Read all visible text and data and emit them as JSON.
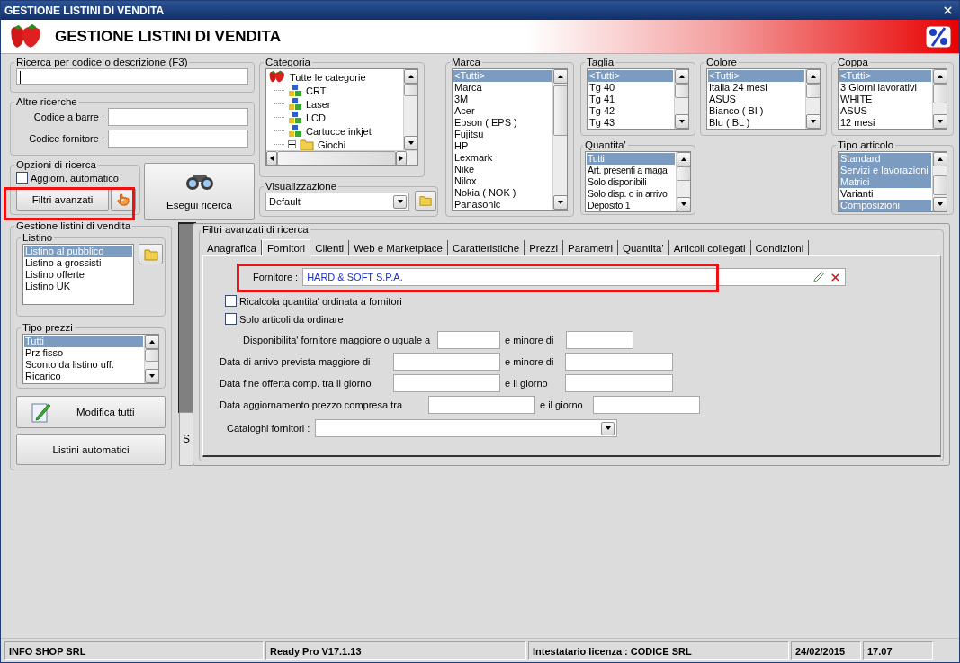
{
  "window": {
    "title": "GESTIONE LISTINI DI VENDITA"
  },
  "header": {
    "title": "GESTIONE LISTINI DI VENDITA"
  },
  "search_code": {
    "label": "Ricerca per codice o descrizione (F3)"
  },
  "other_searches": {
    "label": "Altre ricerche",
    "fields": [
      {
        "label": "Codice a barre :"
      },
      {
        "label": "Codice fornitore :"
      }
    ]
  },
  "search_options": {
    "label": "Opzioni di ricerca",
    "auto_update": {
      "label": "Aggiorn. automatico",
      "checked": false
    },
    "advanced_button": "Filtri avanzati"
  },
  "run_search_button": "Esegui ricerca",
  "category": {
    "label": "Categoria",
    "tree": [
      {
        "label": "Tutte le categorie",
        "kind": "root",
        "children": [
          {
            "label": "CRT",
            "kind": "category"
          },
          {
            "label": "Laser",
            "kind": "category"
          },
          {
            "label": "LCD",
            "kind": "category"
          },
          {
            "label": "Cartucce inkjet",
            "kind": "category"
          },
          {
            "label": "Giochi",
            "kind": "folder",
            "expanded": false
          }
        ]
      }
    ]
  },
  "view": {
    "label": "Visualizzazione",
    "value": "Default"
  },
  "brand": {
    "label": "Marca",
    "items": [
      {
        "label": "<Tutti>",
        "selected": true
      },
      {
        "label": "Marca",
        "selected": false
      },
      {
        "label": "3M",
        "selected": false
      },
      {
        "label": "Acer",
        "selected": false
      },
      {
        "label": "Epson ( EPS )",
        "selected": false
      },
      {
        "label": "Fujitsu",
        "selected": false
      },
      {
        "label": "HP",
        "selected": false
      },
      {
        "label": "Lexmark",
        "selected": false
      },
      {
        "label": "Nike",
        "selected": false
      },
      {
        "label": "Nilox",
        "selected": false
      },
      {
        "label": "Nokia ( NOK )",
        "selected": false
      },
      {
        "label": "Panasonic",
        "selected": false
      }
    ]
  },
  "size": {
    "label": "Taglia",
    "items": [
      {
        "label": "<Tutti>",
        "selected": true
      },
      {
        "label": "Tg 40",
        "selected": false
      },
      {
        "label": "Tg 41",
        "selected": false
      },
      {
        "label": "Tg 42",
        "selected": false
      },
      {
        "label": "Tg 43",
        "selected": false
      }
    ]
  },
  "quantity": {
    "label": "Quantita'",
    "items": [
      {
        "label": "Tutti",
        "selected": true
      },
      {
        "label": "Art. presenti a maga",
        "selected": false
      },
      {
        "label": "Solo disponibili",
        "selected": false
      },
      {
        "label": "Solo disp. o in arrivo",
        "selected": false
      },
      {
        "label": "Deposito 1",
        "selected": false
      }
    ]
  },
  "color": {
    "label": "Colore",
    "items": [
      {
        "label": "<Tutti>",
        "selected": true
      },
      {
        "label": "Italia 24 mesi",
        "selected": false
      },
      {
        "label": "ASUS",
        "selected": false
      },
      {
        "label": "Bianco ( BI )",
        "selected": false
      },
      {
        "label": "Blu ( BL )",
        "selected": false
      }
    ]
  },
  "cup": {
    "label": "Coppa",
    "items": [
      {
        "label": "<Tutti>",
        "selected": true
      },
      {
        "label": "3 Giorni lavorativi",
        "selected": false
      },
      {
        "label": "WHITE",
        "selected": false
      },
      {
        "label": "ASUS",
        "selected": false
      },
      {
        "label": "12 mesi",
        "selected": false
      }
    ]
  },
  "article_type": {
    "label": "Tipo articolo",
    "items": [
      {
        "label": "Standard",
        "selected": true
      },
      {
        "label": "Servizi e lavorazioni",
        "selected": true
      },
      {
        "label": "Matrici",
        "selected": true
      },
      {
        "label": "Varianti",
        "selected": false
      },
      {
        "label": "Composizioni",
        "selected": true
      }
    ]
  },
  "price_lists": {
    "label": "Gestione listini di vendita",
    "list": {
      "label": "Listino",
      "items": [
        {
          "label": "Listino al pubblico",
          "selected": true
        },
        {
          "label": "Listino a grossisti",
          "selected": false
        },
        {
          "label": "Listino offerte",
          "selected": false
        },
        {
          "label": "Listino UK",
          "selected": false
        }
      ]
    },
    "price_types": {
      "label": "Tipo prezzi",
      "items": [
        {
          "label": "Tutti",
          "selected": true
        },
        {
          "label": "Prz fisso",
          "selected": false
        },
        {
          "label": "Sconto da listino uff.",
          "selected": false
        },
        {
          "label": "Ricarico",
          "selected": false
        }
      ]
    },
    "buttons": [
      "Modifica tutti",
      "Listini automatici"
    ]
  },
  "covered_button": "S",
  "advanced_filters": {
    "title": "Filtri avanzati di ricerca",
    "tabs": [
      {
        "label": "Anagrafica",
        "selected": false
      },
      {
        "label": "Fornitori",
        "selected": true
      },
      {
        "label": "Clienti",
        "selected": false
      },
      {
        "label": "Web e Marketplace",
        "selected": false
      },
      {
        "label": "Caratteristiche",
        "selected": false
      },
      {
        "label": "Prezzi",
        "selected": false
      },
      {
        "label": "Parametri",
        "selected": false
      },
      {
        "label": "Quantita'",
        "selected": false
      },
      {
        "label": "Articoli collegati",
        "selected": false
      },
      {
        "label": "Condizioni",
        "selected": false
      }
    ],
    "supplier": {
      "label": "Fornitore :",
      "value": "HARD & SOFT S.P.A."
    },
    "checkboxes": [
      {
        "label": "Ricalcola quantita' ordinata a fornitori",
        "checked": false
      },
      {
        "label": "Solo articoli da ordinare",
        "checked": false
      }
    ],
    "ranges": [
      {
        "label": "Disponibilita' fornitore maggiore o uguale a",
        "connector": "e minore di"
      },
      {
        "label": "Data di arrivo prevista maggiore di",
        "connector": "e minore di"
      },
      {
        "label": "Data fine offerta comp. tra il giorno",
        "connector": "e il giorno"
      },
      {
        "label": "Data aggiornamento prezzo compresa tra",
        "connector": "e il giorno"
      }
    ],
    "catalogs": {
      "label": "Cataloghi fornitori :"
    }
  },
  "status_bar": [
    {
      "text": "INFO SHOP SRL"
    },
    {
      "text": "Ready Pro V17.1.13"
    },
    {
      "text": "Intestatario licenza : CODICE SRL"
    },
    {
      "text": "24/02/2015"
    },
    {
      "text": "17.07"
    }
  ]
}
